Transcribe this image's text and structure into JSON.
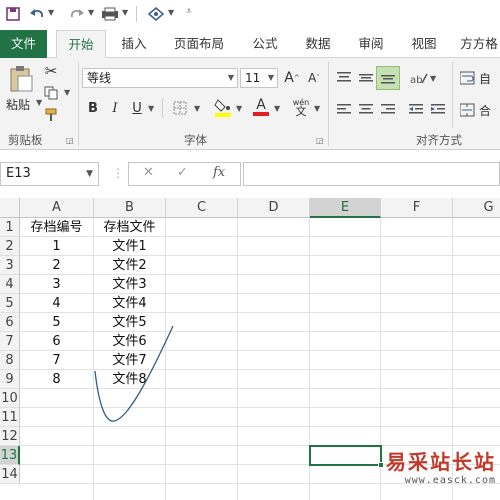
{
  "tabs": [
    {
      "label": "文件"
    },
    {
      "label": "开始"
    },
    {
      "label": "插入"
    },
    {
      "label": "页面布局"
    },
    {
      "label": "公式"
    },
    {
      "label": "数据"
    },
    {
      "label": "审阅"
    },
    {
      "label": "视图"
    },
    {
      "label": "方方格"
    }
  ],
  "ribbon": {
    "paste_label": "粘贴",
    "font_name": "等线",
    "font_size": "11",
    "groups": {
      "clipboard": "剪贴板",
      "font": "字体",
      "alignment": "对齐方式"
    },
    "bold": "B",
    "italic": "I",
    "underline": "U",
    "font_color_glyph": "A",
    "wrap_label": "自",
    "merge_label": "合"
  },
  "formula_bar": {
    "name_box": "E13",
    "cancel": "✕",
    "enter": "✓",
    "fx": "fx",
    "formula": ""
  },
  "sheet": {
    "columns": [
      "A",
      "B",
      "C",
      "D",
      "E",
      "F",
      "G"
    ],
    "selected_column": "E",
    "rows": [
      "1",
      "2",
      "3",
      "4",
      "5",
      "6",
      "7",
      "8",
      "9",
      "10",
      "11",
      "12",
      "13",
      "14"
    ],
    "selected_row": "13",
    "header_row": [
      "存档编号",
      "存档文件"
    ],
    "data": [
      [
        "1",
        "文件1"
      ],
      [
        "2",
        "文件2"
      ],
      [
        "3",
        "文件3"
      ],
      [
        "4",
        "文件4"
      ],
      [
        "5",
        "文件5"
      ],
      [
        "6",
        "文件6"
      ],
      [
        "7",
        "文件7"
      ],
      [
        "8",
        "文件8"
      ]
    ]
  },
  "watermark": {
    "title": "易采站长站",
    "url": "www.easck.com"
  },
  "colors": {
    "accent": "#217346",
    "annotation_stroke": "#2e5f8a"
  }
}
